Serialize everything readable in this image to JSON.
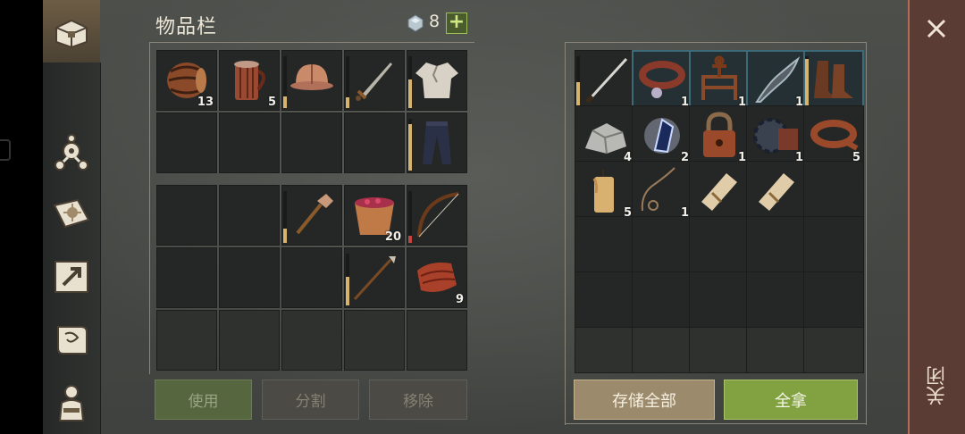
{
  "inventory": {
    "title": "物品栏",
    "currency_count": "8",
    "plus_label": "+"
  },
  "inventory_items": [
    {
      "name": "barrel",
      "qty": "13"
    },
    {
      "name": "wooden-mug",
      "qty": "5"
    },
    {
      "name": "leather-helmet",
      "qty": ""
    },
    {
      "name": "sword",
      "qty": ""
    },
    {
      "name": "shirt",
      "qty": ""
    },
    {
      "name": "pants",
      "qty": ""
    },
    {
      "name": "shovel",
      "qty": ""
    },
    {
      "name": "berry-bucket",
      "qty": "20"
    },
    {
      "name": "bow",
      "qty": ""
    },
    {
      "name": "spear",
      "qty": ""
    },
    {
      "name": "leather",
      "qty": "9"
    }
  ],
  "storage_items": [
    {
      "name": "katana",
      "qty": ""
    },
    {
      "name": "dog-collar",
      "qty": "1"
    },
    {
      "name": "anchor-frame",
      "qty": "1"
    },
    {
      "name": "dragon-blade",
      "qty": "1"
    },
    {
      "name": "boots",
      "qty": ""
    },
    {
      "name": "stone",
      "qty": "4"
    },
    {
      "name": "crystal",
      "qty": "2"
    },
    {
      "name": "padlock",
      "qty": "1"
    },
    {
      "name": "gear-part",
      "qty": "1"
    },
    {
      "name": "belt",
      "qty": "5"
    },
    {
      "name": "candle",
      "qty": "5"
    },
    {
      "name": "rope",
      "qty": "1"
    },
    {
      "name": "scroll-1",
      "qty": ""
    },
    {
      "name": "scroll-2",
      "qty": ""
    }
  ],
  "buttons": {
    "use": "使用",
    "split": "分割",
    "remove": "移除",
    "store_all": "存储全部",
    "take_all": "全拿"
  },
  "close": {
    "label": "关闭",
    "icon": "close-icon"
  },
  "colors": {
    "accent_green": "#82a140",
    "gold_button": "#9b8b6c",
    "close_strip": "#5b3c35"
  }
}
